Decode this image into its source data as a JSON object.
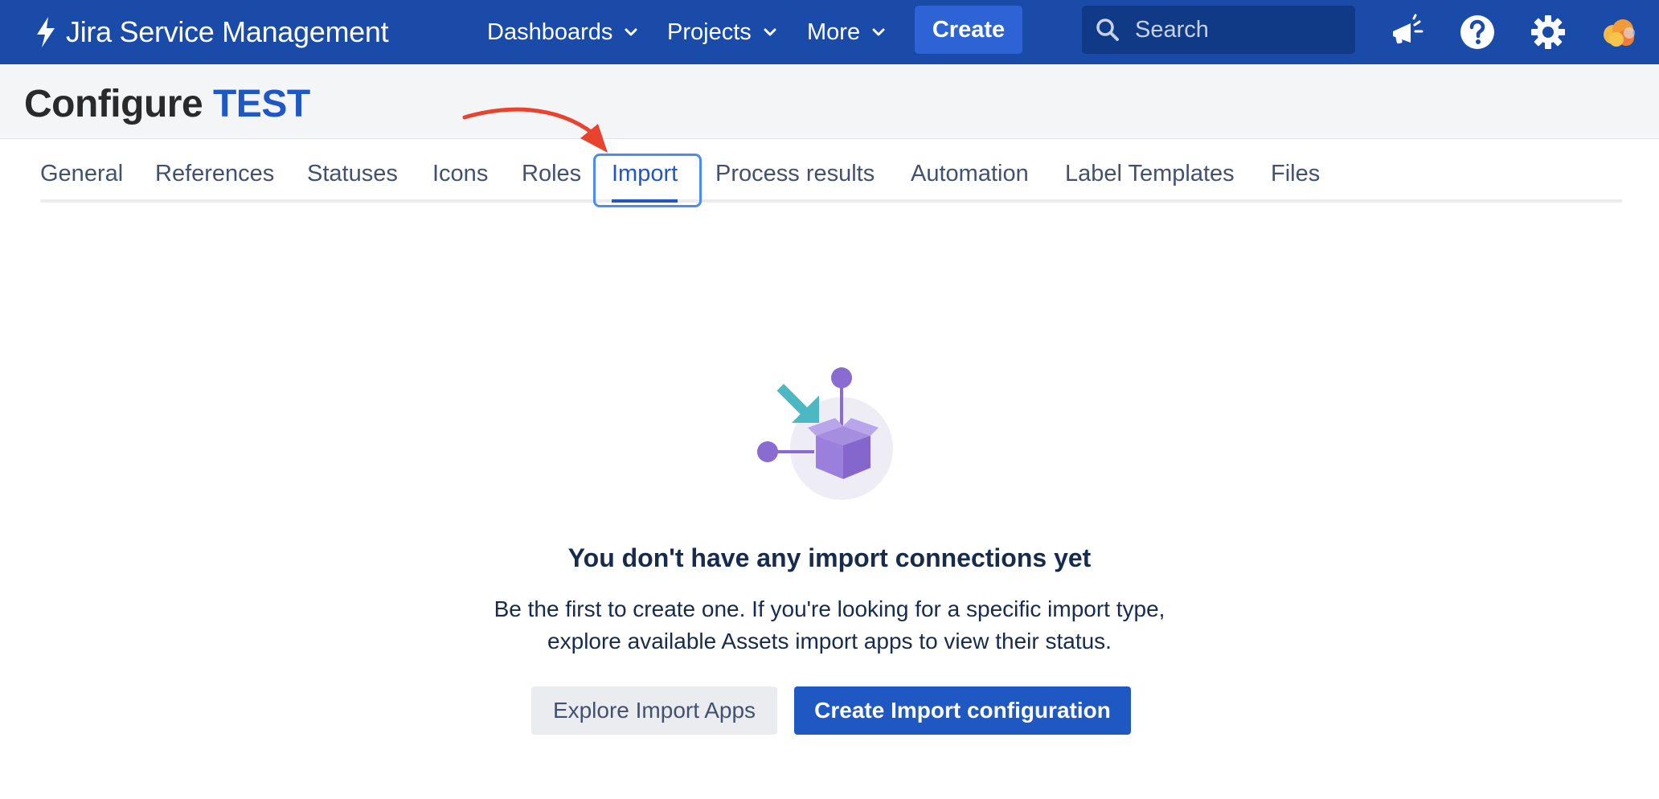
{
  "app": {
    "name": "Jira Service Management"
  },
  "nav": {
    "items": [
      {
        "label": "Dashboards",
        "has_dropdown": true
      },
      {
        "label": "Projects",
        "has_dropdown": true
      },
      {
        "label": "More",
        "has_dropdown": true
      }
    ],
    "create_label": "Create",
    "search_placeholder": "Search",
    "icons": [
      "megaphone-icon",
      "help-icon",
      "gear-icon",
      "avatar-icon"
    ]
  },
  "header": {
    "title_prefix": "Configure",
    "project_key": "TEST"
  },
  "tabs": [
    {
      "label": "General"
    },
    {
      "label": "References"
    },
    {
      "label": "Statuses"
    },
    {
      "label": "Icons"
    },
    {
      "label": "Roles"
    },
    {
      "label": "Import",
      "active": true
    },
    {
      "label": "Process results"
    },
    {
      "label": "Automation"
    },
    {
      "label": "Label Templates"
    },
    {
      "label": "Files"
    }
  ],
  "empty_state": {
    "title": "You don't have any import connections yet",
    "description_line1": "Be the first to create one. If you're looking for a specific import type,",
    "description_line2": "explore available Assets import apps to view their status.",
    "secondary_button": "Explore Import Apps",
    "primary_button": "Create Import configuration"
  },
  "colors": {
    "topbar": "#1a4ba8",
    "brand_blue": "#1f57c3",
    "annotation_arrow": "#e8432f",
    "illustration_purple": "#8a6bd1",
    "illustration_teal": "#4bb8c4"
  }
}
